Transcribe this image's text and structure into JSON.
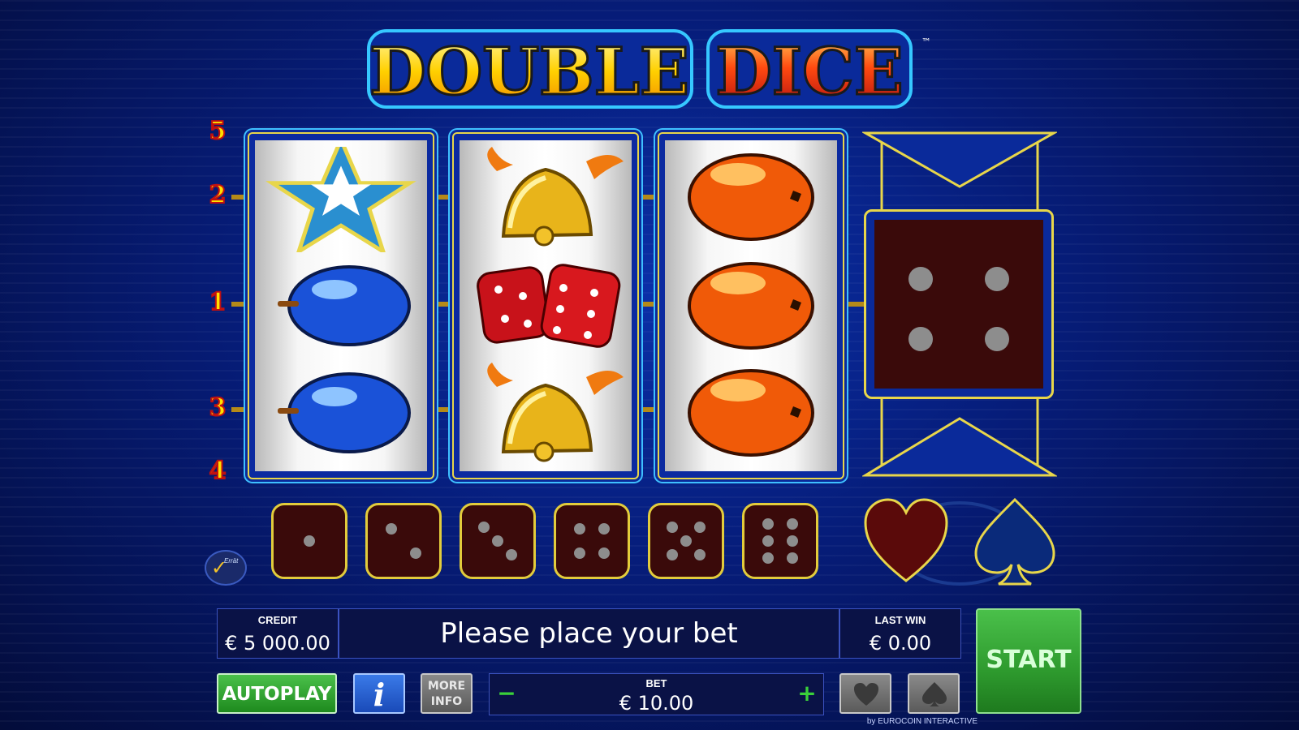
{
  "game": {
    "title_left": "DOUBLE",
    "title_right": "DICE",
    "trademark": "™"
  },
  "paylines": [
    "5",
    "2",
    "1",
    "3",
    "4"
  ],
  "reels": [
    {
      "symbols": [
        "star-icon",
        "plum-icon",
        "plum-icon"
      ]
    },
    {
      "symbols": [
        "bell-icon",
        "dice-icon",
        "bell-icon"
      ]
    },
    {
      "symbols": [
        "orange-icon",
        "orange-icon",
        "orange-icon"
      ]
    }
  ],
  "gamble_die_value": 4,
  "dice_row": [
    1,
    2,
    3,
    4,
    5,
    6
  ],
  "suits": [
    "heart-icon",
    "spade-icon"
  ],
  "status": {
    "credit_label": "CREDIT",
    "credit_value": "€ 5 000.00",
    "message": "Please place your bet",
    "last_win_label": "LAST WIN",
    "last_win_value": "€ 0.00"
  },
  "controls": {
    "autoplay": "AUTOPLAY",
    "info": "i",
    "more_info_1": "MORE",
    "more_info_2": "INFO",
    "bet_label": "BET",
    "bet_value": "€ 10.00",
    "bet_minus": "−",
    "bet_plus": "+",
    "start": "START"
  },
  "badge": "Errät",
  "footer": "by EUROCOIN INTERACTIVE",
  "colors": {
    "background": "#061c78",
    "gold": "#e8d64a",
    "start_green": "#2e9a2e",
    "die_red": "#3a0a0a"
  }
}
